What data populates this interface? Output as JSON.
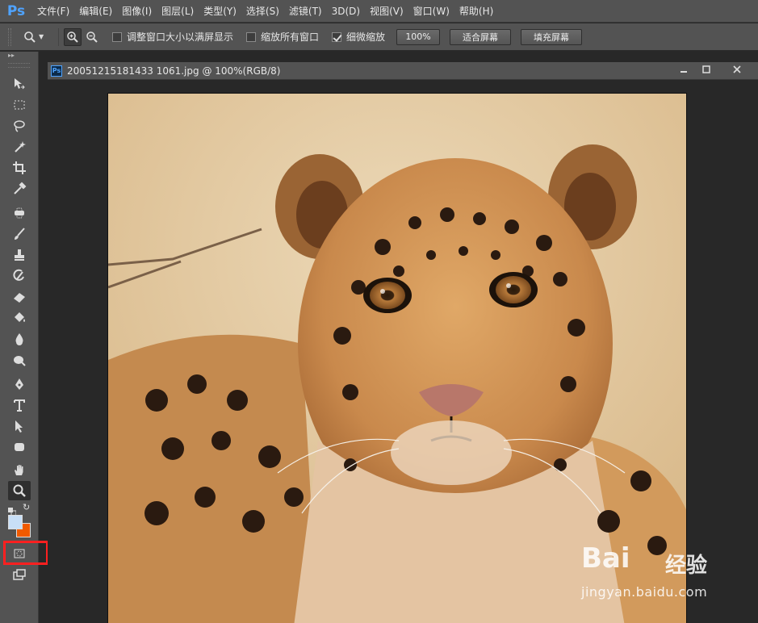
{
  "app": {
    "logo": "Ps"
  },
  "menubar": {
    "items": [
      "文件(F)",
      "编辑(E)",
      "图像(I)",
      "图层(L)",
      "类型(Y)",
      "选择(S)",
      "滤镜(T)",
      "3D(D)",
      "视图(V)",
      "窗口(W)",
      "帮助(H)"
    ]
  },
  "options": {
    "resize_windows_label": "调整窗口大小以满屏显示",
    "zoom_all_label": "缩放所有窗口",
    "scrubby_zoom_label": "细微缩放",
    "scrubby_zoom_checked": true,
    "percent_button": "100%",
    "fit_screen_button": "适合屏幕",
    "fill_screen_button": "填充屏幕"
  },
  "document": {
    "title": "20051215181433 1061.jpg @ 100%(RGB/8)",
    "icon_label": "Ps"
  },
  "colors": {
    "foreground": "#c8dff7",
    "background": "#f05a00",
    "highlight": "#ff2020"
  },
  "tools": [
    "move-tool",
    "marquee-tool",
    "lasso-tool",
    "magic-wand-tool",
    "crop-tool",
    "eyedropper-tool",
    "healing-brush-tool",
    "brush-tool",
    "clone-stamp-tool",
    "history-brush-tool",
    "eraser-tool",
    "paint-bucket-tool",
    "blur-tool",
    "dodge-tool",
    "pen-tool",
    "type-tool",
    "path-selection-tool",
    "shape-tool",
    "hand-tool",
    "zoom-tool"
  ],
  "watermark": {
    "logo": "Bai",
    "brand_cn": "经验",
    "url": "jingyan.baidu.com"
  }
}
